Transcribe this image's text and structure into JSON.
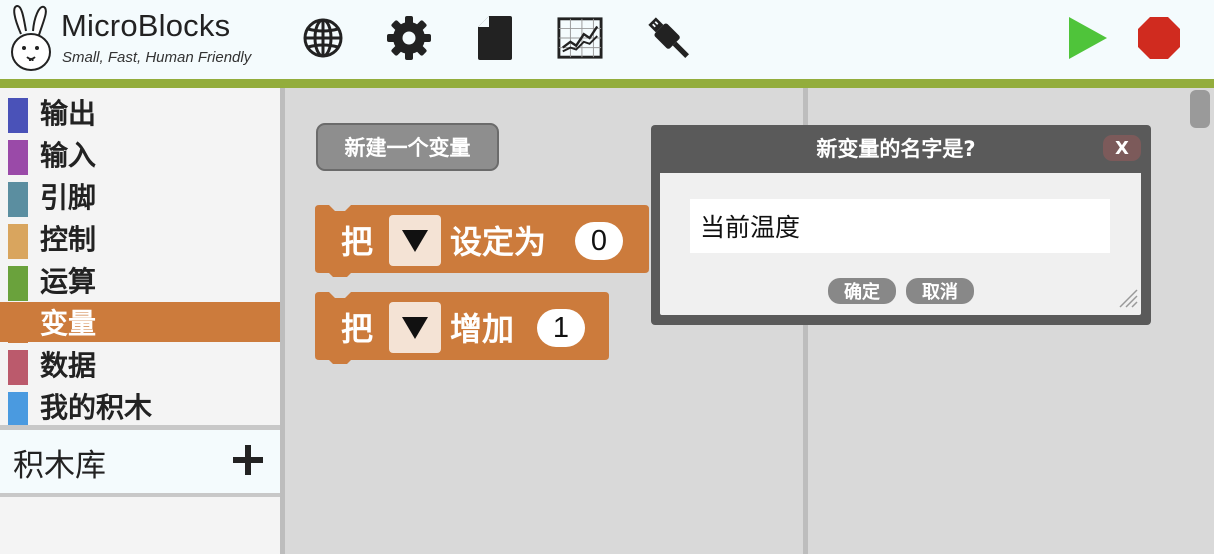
{
  "app": {
    "title": "MicroBlocks",
    "tagline": "Small, Fast, Human Friendly"
  },
  "toolbar": {
    "icons": [
      "globe-icon",
      "gear-icon",
      "file-icon",
      "graph-icon",
      "usb-plug-icon",
      "start-icon",
      "stop-icon"
    ],
    "colors": {
      "start": "#4fc43a",
      "stop": "#d02b1f",
      "accent_line": "#93ad3c"
    }
  },
  "palette": {
    "categories": [
      {
        "label": "输出",
        "color": "#4a52b8"
      },
      {
        "label": "输入",
        "color": "#9a4aa8"
      },
      {
        "label": "引脚",
        "color": "#5b8ea0"
      },
      {
        "label": "控制",
        "color": "#d9a55e"
      },
      {
        "label": "运算",
        "color": "#6aa23c"
      },
      {
        "label": "变量",
        "color": "#cc7b3c",
        "selected": true
      },
      {
        "label": "数据",
        "color": "#bb5a6c"
      },
      {
        "label": "我的积木",
        "color": "#4a9ae0"
      }
    ],
    "library_label": "积木库"
  },
  "blocks": {
    "new_variable_button": "新建一个变量",
    "set_block": {
      "prefix": "把",
      "action": "设定为",
      "value": "0"
    },
    "change_block": {
      "prefix": "把",
      "action": "增加",
      "value": "1"
    },
    "block_color": "#cc7b3c"
  },
  "dialog": {
    "title": "新变量的名字是?",
    "close_label": "X",
    "input_value": "当前温度",
    "ok_label": "确定",
    "cancel_label": "取消"
  }
}
